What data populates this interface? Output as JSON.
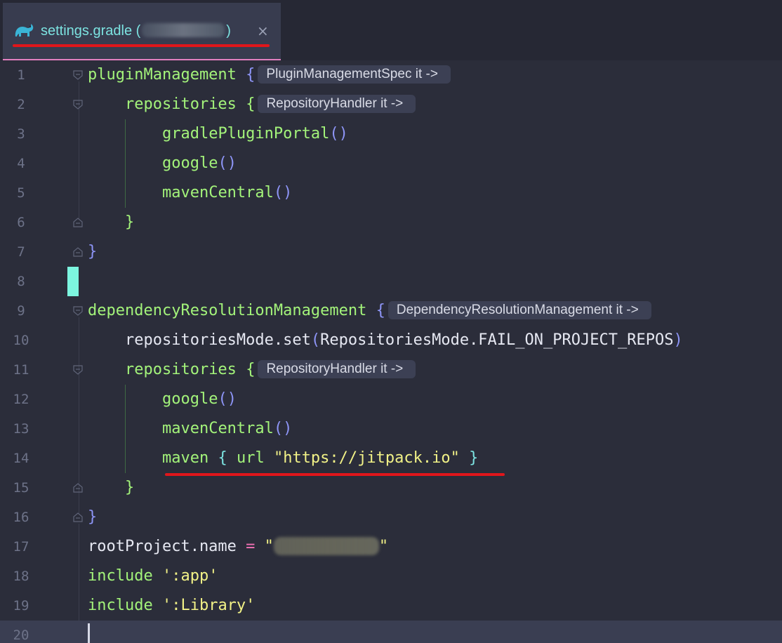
{
  "tab": {
    "title_prefix": "settings.gradle (",
    "title_suffix": ")",
    "close_glyph": "×",
    "icon": "gradle-elephant-icon"
  },
  "editor": {
    "lines": [
      {
        "num": "1"
      },
      {
        "num": "2"
      },
      {
        "num": "3"
      },
      {
        "num": "4"
      },
      {
        "num": "5"
      },
      {
        "num": "6"
      },
      {
        "num": "7"
      },
      {
        "num": "8"
      },
      {
        "num": "9"
      },
      {
        "num": "10"
      },
      {
        "num": "11"
      },
      {
        "num": "12"
      },
      {
        "num": "13"
      },
      {
        "num": "14"
      },
      {
        "num": "15"
      },
      {
        "num": "16"
      },
      {
        "num": "17"
      },
      {
        "num": "18"
      },
      {
        "num": "19"
      },
      {
        "num": "20"
      }
    ],
    "code": {
      "l1_fn": "pluginManagement",
      "l1_hint": "PluginManagementSpec it ->",
      "l2_fn": "repositories",
      "l2_hint": "RepositoryHandler it ->",
      "l3_fn": "gradlePluginPortal",
      "l4_fn": "google",
      "l5_fn": "mavenCentral",
      "l9_fn": "dependencyResolutionManagement",
      "l9_hint": "DependencyResolutionManagement it ->",
      "l10_a": "repositoriesMode.set",
      "l10_b": "RepositoriesMode.FAIL_ON_PROJECT_REPOS",
      "l11_fn": "repositories",
      "l11_hint": "RepositoryHandler it ->",
      "l12_fn": "google",
      "l13_fn": "mavenCentral",
      "l14_fn": "maven",
      "l14_url": "url",
      "l14_str": "\"https://jitpack.io\"",
      "l17_a": "rootProject.name",
      "l17_eq": "=",
      "l18_kw": "include",
      "l18_str": "':app'",
      "l19_kw": "include",
      "l19_str": "':Library'"
    }
  },
  "colors": {
    "background": "#2b2d3a",
    "function": "#a3f37a",
    "string": "#f2f287",
    "paren": "#8e95f7",
    "annotation_underline": "#e0161b",
    "tab_text": "#7ce3e1"
  }
}
